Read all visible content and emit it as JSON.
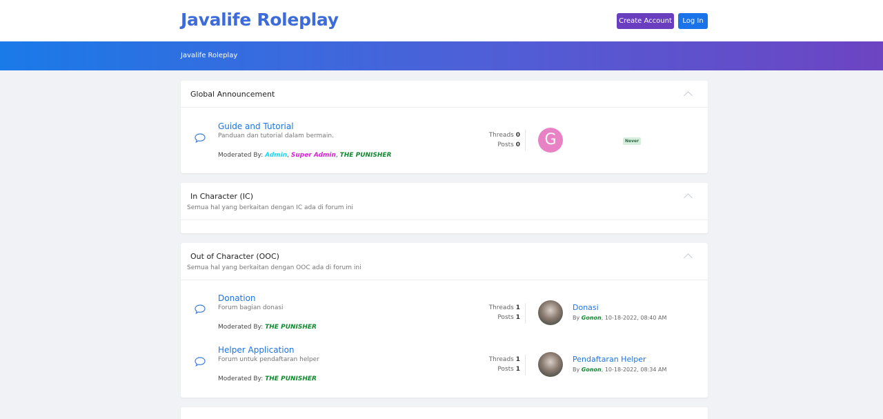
{
  "header": {
    "logo": "Javalife Roleplay",
    "create_account": "Create Account",
    "login": "Log In"
  },
  "banner": {
    "breadcrumb": "Javalife Roleplay"
  },
  "colors": {
    "primary": "#1a73e8",
    "purple": "#6a3fbf",
    "logo": "#3d6bd8"
  },
  "categories": [
    {
      "title": "Global Announcement",
      "description": "",
      "forums": [
        {
          "name": "Guide and Tutorial",
          "description": "Panduan dan tutorial dalam bermain.",
          "moderated_label": "Moderated By:",
          "moderators": [
            "Admin",
            "Super Admin",
            "THE PUNISHER"
          ],
          "threads_label": "Threads",
          "threads": "0",
          "posts_label": "Posts",
          "posts": "0",
          "avatar_letter": "G",
          "last_post": "Never"
        }
      ]
    },
    {
      "title": "In Character (IC)",
      "description": "Semua hal yang berkaitan dengan IC ada di forum ini",
      "forums": []
    },
    {
      "title": "Out of Character (OOC)",
      "description": "Semua hal yang berkaitan dengan OOC ada di forum ini",
      "forums": [
        {
          "name": "Donation",
          "description": "Forum bagian donasi",
          "moderated_label": "Moderated By:",
          "moderators": [
            "THE PUNISHER"
          ],
          "threads_label": "Threads",
          "threads": "1",
          "posts_label": "Posts",
          "posts": "1",
          "last_title": "Donasi",
          "last_by": "By",
          "last_user": "Gonon",
          "last_date": ", 10-18-2022, 08:40 AM"
        },
        {
          "name": "Helper Application",
          "description": "Forum untuk pendaftaran helper",
          "moderated_label": "Moderated By:",
          "moderators": [
            "THE PUNISHER"
          ],
          "threads_label": "Threads",
          "threads": "1",
          "posts_label": "Posts",
          "posts": "1",
          "last_title": "Pendaftaran Helper",
          "last_by": "By",
          "last_user": "Gonon",
          "last_date": ", 10-18-2022, 08:34 AM"
        }
      ]
    }
  ]
}
